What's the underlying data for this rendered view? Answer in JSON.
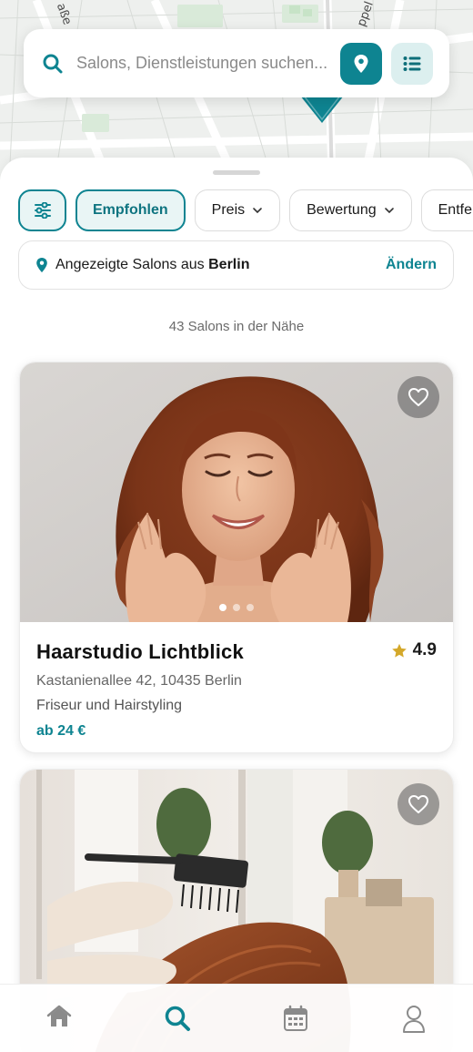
{
  "map": {
    "street_left": "aße",
    "street_right": "ppel"
  },
  "search": {
    "placeholder": "Salons, Dienstleistungen suchen..."
  },
  "icons": {
    "search": "search-icon",
    "location": "map-pin-icon",
    "list": "list-icon",
    "filter": "sliders-icon",
    "heart": "heart-icon",
    "star": "star-icon",
    "home": "home-icon",
    "calendar": "calendar-icon",
    "profile": "user-icon"
  },
  "colors": {
    "accent": "#0e8491",
    "accent_light": "#e9f5f5",
    "star": "#d4a82a"
  },
  "filters": {
    "chips": [
      "Empfohlen",
      "Preis",
      "Bewertung",
      "Entfe"
    ]
  },
  "location": {
    "prefix": "Angezeigte Salons aus",
    "city": "Berlin",
    "change_label": "Ändern"
  },
  "results": {
    "count_text": "43 Salons in der Nähe"
  },
  "salons": [
    {
      "name": "Haarstudio Lichtblick",
      "rating": "4.9",
      "address": "Kastanienallee 42, 10435 Berlin",
      "category": "Friseur und Hairstyling",
      "price": "ab 24 €",
      "image_count": 3,
      "active_image": 1
    },
    {
      "name": "",
      "rating": "",
      "address": "",
      "category": "",
      "price": ""
    }
  ],
  "bottom_nav": {
    "items": [
      "home",
      "search",
      "calendar",
      "profile"
    ],
    "active": "search"
  }
}
